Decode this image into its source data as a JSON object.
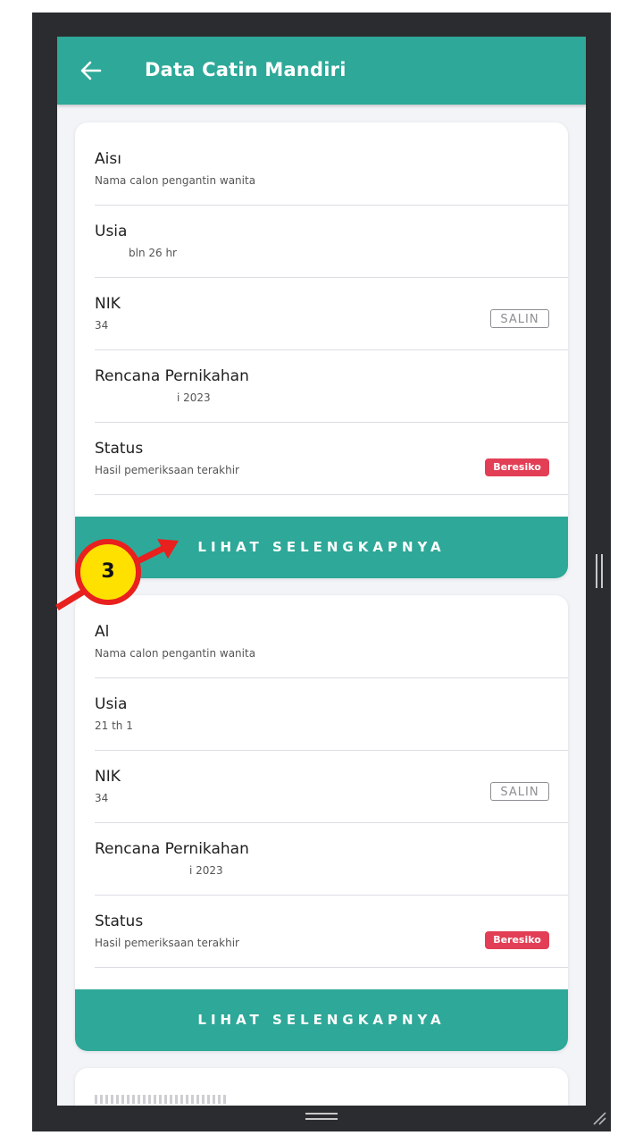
{
  "header": {
    "title": "Data Catin Mandiri",
    "back_icon": "arrow-left-icon"
  },
  "cards": [
    {
      "name_label": "Aisı",
      "name_caption": "Nama calon pengantin wanita",
      "usia_label": "Usia",
      "usia_value": "bln 26 hr",
      "nik_label": "NIK",
      "nik_value": "34",
      "salin_label": "SALIN",
      "rencana_label": "Rencana Pernikahan",
      "rencana_value": "i 2023",
      "status_label": "Status",
      "status_caption": "Hasil pemeriksaan terakhir",
      "status_badge": "Beresiko",
      "cta_label": "LIHAT SELENGKAPNYA"
    },
    {
      "name_label": "Al",
      "name_caption": "Nama calon pengantin wanita",
      "usia_label": "Usia",
      "usia_value": "21 th 1",
      "nik_label": "NIK",
      "nik_value": "34",
      "salin_label": "SALIN",
      "rencana_label": "Rencana Pernikahan",
      "rencana_value": "i 2023",
      "status_label": "Status",
      "status_caption": "Hasil pemeriksaan terakhir",
      "status_badge": "Beresiko",
      "cta_label": "LIHAT SELENGKAPNYA"
    }
  ],
  "annotation": {
    "step_number": "3"
  },
  "colors": {
    "accent": "#2ea898",
    "badge": "#e23e55",
    "callout_fill": "#ffe100",
    "callout_ring": "#e8201e"
  }
}
